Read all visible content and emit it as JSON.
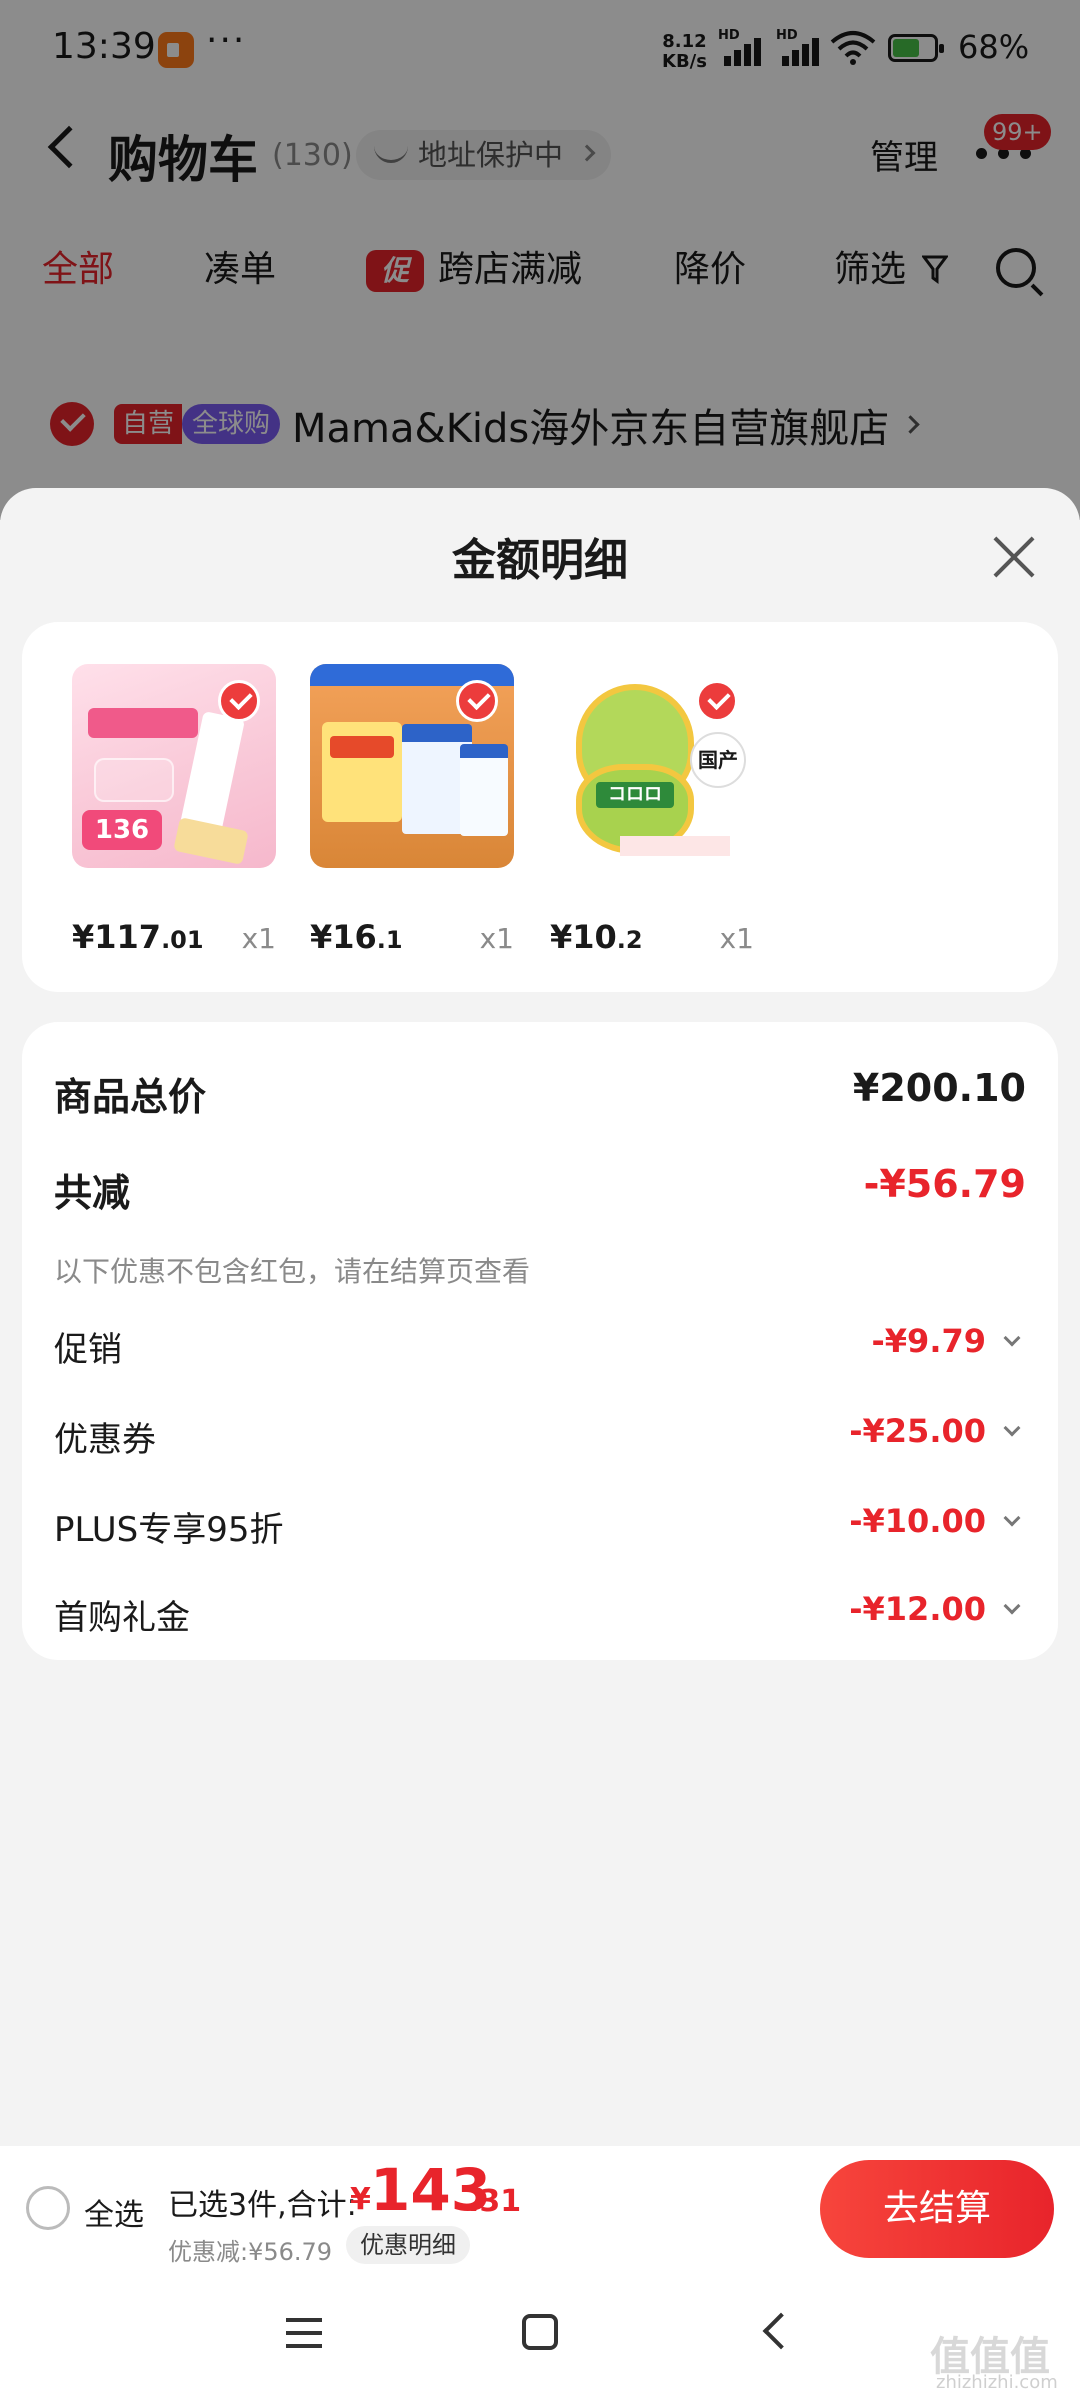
{
  "status_bar": {
    "time": "13:39",
    "dots": "···",
    "net_speed_value": "8.12",
    "net_speed_unit": "KB/s",
    "hd_label": "HD",
    "battery_pct": "68%"
  },
  "nav": {
    "title": "购物车",
    "count": "(130)",
    "address_label": "地址保护中",
    "manage_label": "管理",
    "badge": "99+"
  },
  "tabs": [
    {
      "label": "全部",
      "active": true
    },
    {
      "label": "凑单"
    },
    {
      "label": "跨店满减",
      "tag": "促"
    },
    {
      "label": "降价"
    },
    {
      "label": "筛选"
    }
  ],
  "store": {
    "tag_self": "自营",
    "tag_global": "全球购",
    "name": "Mama&Kids海外京东自营旗舰店"
  },
  "sheet": {
    "title": "金额明细",
    "products": [
      {
        "price_int": "¥117",
        "price_dec": ".01",
        "qty": "x1",
        "icon": "cream-tube-product",
        "img_tag": "136"
      },
      {
        "price_int": "¥16",
        "price_dec": ".1",
        "qty": "x1",
        "icon": "milk-box-product"
      },
      {
        "price_int": "¥10",
        "price_dec": ".2",
        "qty": "x1",
        "icon": "grape-gummy-product",
        "img_badge": "国产",
        "img_logo": "コロロ"
      }
    ],
    "details": {
      "total_label": "商品总价",
      "total_value": "¥200.10",
      "reduce_label": "共减",
      "reduce_value": "-¥56.79",
      "note": "以下优惠不包含红包，请在结算页查看",
      "items": [
        {
          "label": "促销",
          "value": "-¥9.79"
        },
        {
          "label": "优惠券",
          "value": "-¥25.00"
        },
        {
          "label": "PLUS专享95折",
          "value": "-¥10.00"
        },
        {
          "label": "首购礼金",
          "value": "-¥12.00"
        }
      ]
    }
  },
  "checkout": {
    "select_all": "全选",
    "selected_text": "已选3件,合计:",
    "currency": "¥",
    "total_int": "143",
    "total_dec": ".31",
    "discount_text": "优惠减:¥56.79",
    "detail_pill": "优惠明细",
    "button": "去结算"
  },
  "watermark": {
    "main": "值值值",
    "sub": "zhizhizhi.com"
  },
  "colors": {
    "accent": "#e8242b",
    "global_tag": "#7a5cf2",
    "overlay": "rgba(0,0,0,0.45)"
  }
}
